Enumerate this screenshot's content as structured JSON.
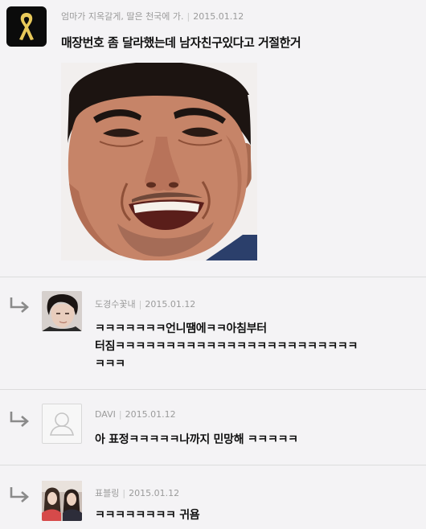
{
  "post": {
    "author": "엄마가 지옥갈게, 딸은 천국에 가.",
    "date": "2015.01.12",
    "text": "매장번호 좀 달라했는데 남자친구있다고 거절한거"
  },
  "comments": [
    {
      "author": "도경수꽃내",
      "date": "2015.01.12",
      "lines": [
        "ㅋㅋㅋㅋㅋㅋㅋ언니땜에ㅋㅋ아침부터",
        "터짐ㅋㅋㅋㅋㅋㅋㅋㅋㅋㅋㅋㅋㅋㅋㅋㅋㅋㅋㅋㅋㅋㅋㅋㅋ",
        "ㅋㅋㅋ"
      ]
    },
    {
      "author": "DAVI",
      "date": "2015.01.12",
      "lines": [
        "아 표정ㅋㅋㅋㅋㅋ나까지 민망해 ㅋㅋㅋㅋㅋ"
      ]
    },
    {
      "author": "표블링",
      "date": "2015.01.12",
      "lines": [
        "ㅋㅋㅋㅋㅋㅋㅋㅋ 귀욤"
      ]
    }
  ],
  "colors": {
    "background": "#f4f3f5",
    "meta_text": "#9b9b9b",
    "ribbon": "#e8c95a"
  },
  "icons": {
    "main_avatar": "yellow-ribbon-icon",
    "reply": "reply-arrow-icon",
    "default_avatar": "default-user-icon"
  }
}
